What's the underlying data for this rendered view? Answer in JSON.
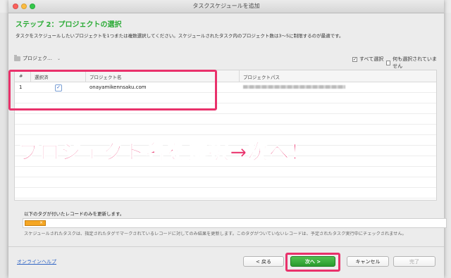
{
  "window": {
    "title": "タスクスケジュールを追加"
  },
  "step": {
    "heading": "ステップ 2：プロジェクトの選択",
    "description": "タスクをスケジュールしたいプロジェクトを1つまたは複数選択してください。スケジュールされたタスク内のプロジェクト数は3〜5に制限するのが最適です。"
  },
  "toolbar": {
    "project_dropdown": "プロジェク…",
    "select_all_label": "すべて選択",
    "select_none_label": "何も選択されていません"
  },
  "table": {
    "headers": {
      "num": "#",
      "selected": "選択済",
      "project_name": "プロジェクト名",
      "project_path": "プロジェクトパス"
    },
    "rows": [
      {
        "num": "1",
        "checked": true,
        "name": "onayamikennsaku.com",
        "path": ""
      }
    ]
  },
  "annotation": {
    "overlay_text": "プロジェクト名を選択→次へ！"
  },
  "tags": {
    "label": "以下のタグが付いたレコードのみを更新します。",
    "description": "スケジュールされたタスクは、指定されたタグでマークされているレコードに対してのみ結果を更新します。このタグがついていないレコードは、予定されたタスク実行中にチェックされません。"
  },
  "footer": {
    "help_link": "オンラインヘルプ",
    "back_label": "< 戻る",
    "next_label": "次へ >",
    "cancel_label": "キャンセル",
    "done_label": "完了"
  },
  "colors": {
    "accent_green": "#2bab36",
    "highlight_pink": "#e9316b",
    "tag_orange": "#f5a623",
    "link_blue": "#2f64c5"
  }
}
